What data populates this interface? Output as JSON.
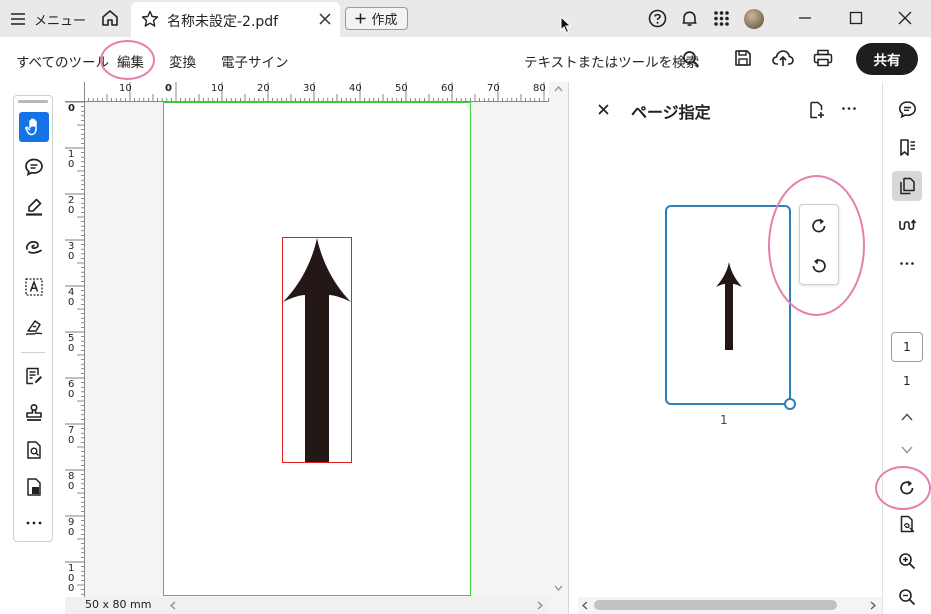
{
  "titlebar": {
    "menu_label": "メニュー",
    "tab_title": "名称未設定-2.pdf",
    "new_button_label": "作成",
    "icons": [
      "hamburger-icon",
      "home-icon",
      "star-icon",
      "close-icon",
      "plus-icon",
      "help-icon",
      "bell-icon",
      "apps-icon",
      "avatar",
      "minimize-icon",
      "maximize-icon",
      "close-window-icon"
    ]
  },
  "toolbar": {
    "items": [
      "すべてのツール",
      "編集",
      "変換",
      "電子サイン"
    ],
    "search_label": "テキストまたはツールを検索",
    "share_label": "共有"
  },
  "ruler": {
    "top_labels": [
      "10",
      "0",
      "10",
      "20",
      "30",
      "40",
      "50",
      "60",
      "70",
      "80"
    ],
    "left_labels": [
      "0",
      "10",
      "20",
      "30",
      "40",
      "50",
      "60",
      "70",
      "80",
      "90",
      "100"
    ]
  },
  "status": {
    "page_size": "50 x 80 mm"
  },
  "panel": {
    "title": "ページ指定",
    "thumbnail_number": "1"
  },
  "rail": {
    "current_page": "1",
    "total_pages": "1"
  },
  "colors": {
    "accent": "#1473e6",
    "page_border": "#3ecf3e",
    "selection_border": "#e02020",
    "arrow": "#231815",
    "thumb_border": "#2d7fb8",
    "annotation": "#e47fb0",
    "share_button": "#1e1e1e"
  }
}
